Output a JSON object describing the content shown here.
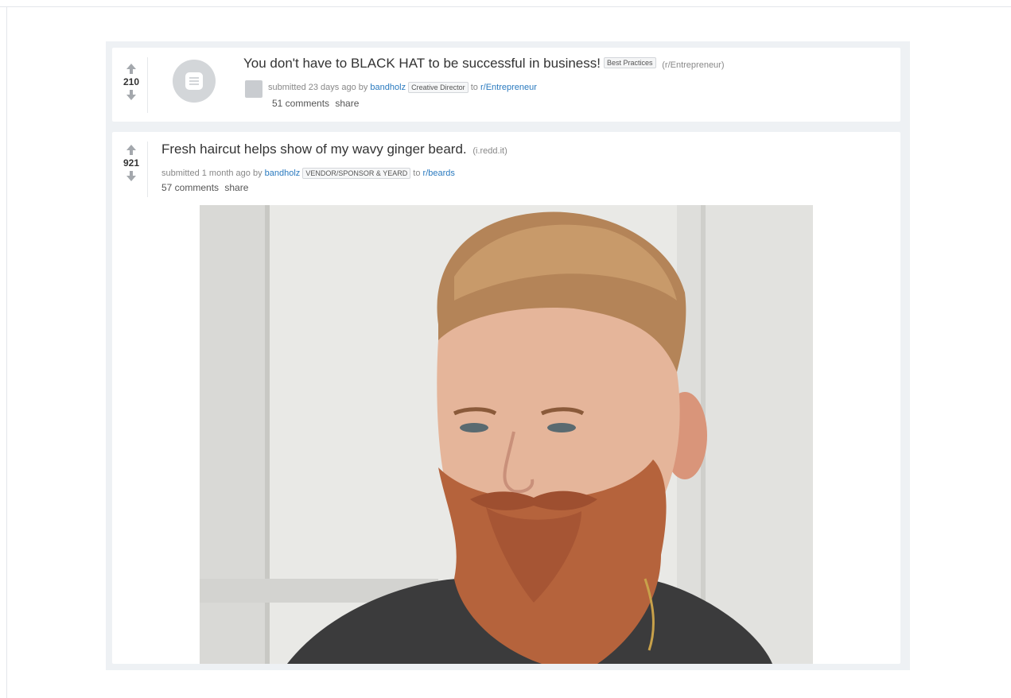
{
  "posts": [
    {
      "score": "210",
      "title": "You don't have to BLACK HAT to be successful in business!",
      "flair": "Best Practices",
      "domain": "(r/Entrepreneur)",
      "submitted": "submitted 23 days ago by",
      "author": "bandholz",
      "user_flair": "Creative Director",
      "to": "to",
      "subreddit": "r/Entrepreneur",
      "comments": "51 comments",
      "share": "share"
    },
    {
      "score": "921",
      "title": "Fresh haircut helps show of my wavy ginger beard.",
      "domain": "(i.redd.it)",
      "submitted": "submitted 1 month ago by",
      "author": "bandholz",
      "user_flair": "VENDOR/SPONSOR & YEARD",
      "to": "to",
      "subreddit": "r/beards",
      "comments": "57 comments",
      "share": "share"
    }
  ],
  "icons": {
    "upvote": "arrow-up",
    "downvote": "arrow-down",
    "thumbnail": "text-post-icon"
  },
  "colors": {
    "link": "#2a7abf",
    "arrow": "#a4a8ad"
  }
}
